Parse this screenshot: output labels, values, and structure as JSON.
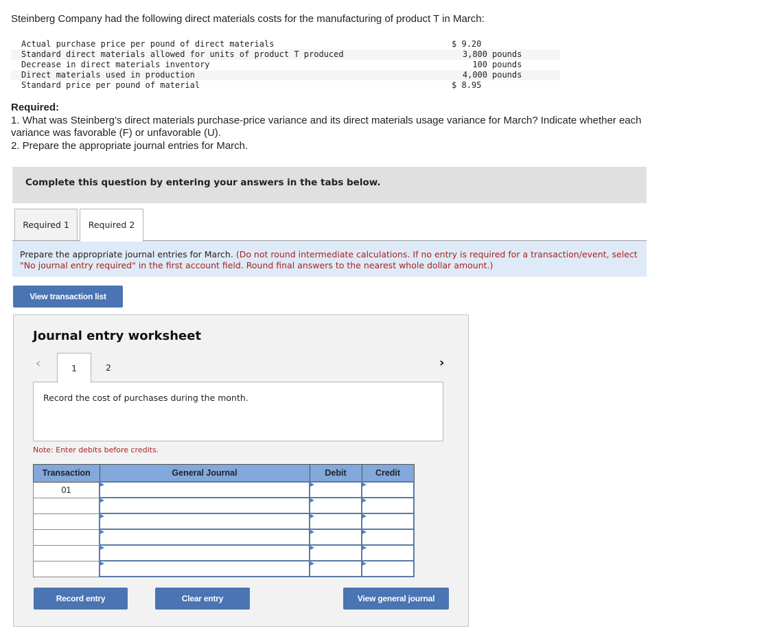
{
  "problem": {
    "intro": "Steinberg Company had the following direct materials costs for the manufacturing of product T in March:",
    "given": [
      {
        "label": "Actual purchase price per pound of direct materials",
        "prefix": "$",
        "value": "9.20",
        "unit": ""
      },
      {
        "label": "Standard direct materials allowed for units of product T produced",
        "prefix": "",
        "value": "3,800",
        "unit": "pounds"
      },
      {
        "label": "Decrease in direct materials inventory",
        "prefix": "",
        "value": "100",
        "unit": "pounds"
      },
      {
        "label": "Direct materials used in production",
        "prefix": "",
        "value": "4,000",
        "unit": "pounds"
      },
      {
        "label": "Standard price per pound of material",
        "prefix": "$",
        "value": "8.95",
        "unit": ""
      }
    ],
    "required_heading": "Required:",
    "required_items": [
      "1. What was Steinberg’s direct materials purchase-price variance and its direct materials usage variance for March? Indicate whether each variance was favorable (F) or unfavorable (U).",
      "2. Prepare the appropriate journal entries for March."
    ]
  },
  "banner": "Complete this question by entering your answers in the tabs below.",
  "tabs": [
    {
      "label": "Required 1",
      "active": false
    },
    {
      "label": "Required 2",
      "active": true
    }
  ],
  "instructions": {
    "main": "Prepare the appropriate journal entries for March.",
    "note": "(Do not round intermediate calculations. If no entry is required for a transaction/event, select \"No journal entry required\" in the first account field. Round final answers to the nearest whole dollar amount.)"
  },
  "buttons": {
    "view_transaction_list": "View transaction list",
    "record_entry": "Record entry",
    "clear_entry": "Clear entry",
    "view_general_journal": "View general journal"
  },
  "worksheet": {
    "title": "Journal entry worksheet",
    "prev_icon": "‹",
    "next_icon": "›",
    "entry_tabs": [
      "1",
      "2"
    ],
    "active_entry": "1",
    "description": "Record the cost of purchases during the month.",
    "note": "Note: Enter debits before credits.",
    "table": {
      "headers": [
        "Transaction",
        "General Journal",
        "Debit",
        "Credit"
      ],
      "rows": [
        {
          "transaction": "01",
          "account": "",
          "debit": "",
          "credit": ""
        },
        {
          "transaction": "",
          "account": "",
          "debit": "",
          "credit": ""
        },
        {
          "transaction": "",
          "account": "",
          "debit": "",
          "credit": ""
        },
        {
          "transaction": "",
          "account": "",
          "debit": "",
          "credit": ""
        },
        {
          "transaction": "",
          "account": "",
          "debit": "",
          "credit": ""
        },
        {
          "transaction": "",
          "account": "",
          "debit": "",
          "credit": ""
        }
      ]
    }
  }
}
